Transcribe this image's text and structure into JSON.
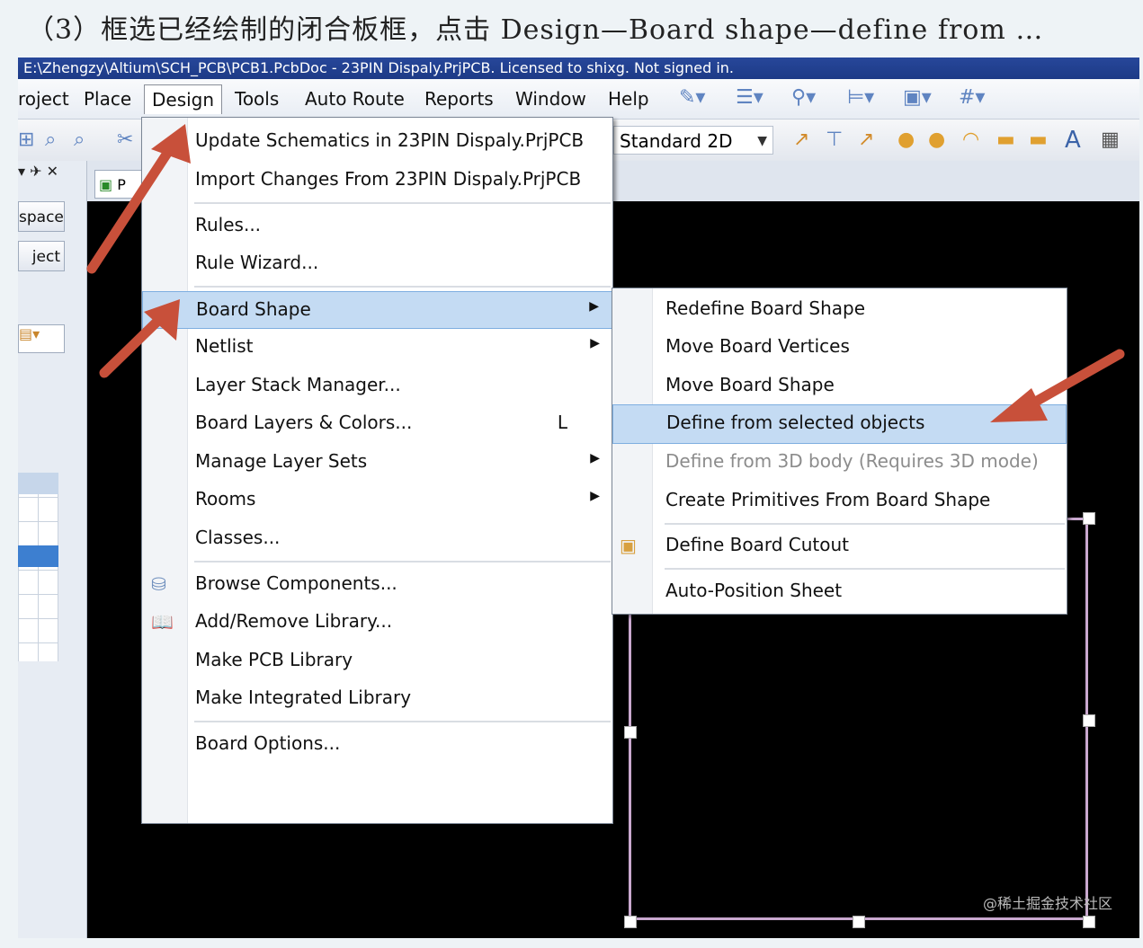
{
  "caption": "（3）框选已经绘制的闭合板框，点击 Design—Board shape—define from …",
  "window": {
    "title": "E:\\Zhengzy\\Altium\\SCH_PCB\\PCB1.PcbDoc - 23PIN Dispaly.PrjPCB. Licensed to shixg. Not signed in."
  },
  "menubar": {
    "project": "roject",
    "place": "Place",
    "design": "Design",
    "tools": "Tools",
    "auto_route": "Auto Route",
    "reports": "Reports",
    "window": "Window",
    "help": "Help"
  },
  "toolbar": {
    "view_mode": "Standard 2D"
  },
  "left_panel": {
    "workspace_btn": "space",
    "project_btn": "ject"
  },
  "doc_tab": {
    "label": "P"
  },
  "design_menu": {
    "items": [
      {
        "label": "Update Schematics in 23PIN Dispaly.PrjPCB"
      },
      {
        "label": "Import Changes From 23PIN Dispaly.PrjPCB"
      },
      {
        "label": "Rules..."
      },
      {
        "label": "Rule Wizard..."
      },
      {
        "label": "Board Shape"
      },
      {
        "label": "Netlist"
      },
      {
        "label": "Layer Stack Manager..."
      },
      {
        "label": "Board Layers & Colors...",
        "shortcut": "L"
      },
      {
        "label": "Manage Layer Sets"
      },
      {
        "label": "Rooms"
      },
      {
        "label": "Classes..."
      },
      {
        "label": "Browse Components..."
      },
      {
        "label": "Add/Remove Library..."
      },
      {
        "label": "Make PCB Library"
      },
      {
        "label": "Make Integrated Library"
      },
      {
        "label": "Board Options..."
      }
    ]
  },
  "board_shape_menu": {
    "items": [
      {
        "label": "Redefine Board Shape"
      },
      {
        "label": "Move Board Vertices"
      },
      {
        "label": "Move Board Shape"
      },
      {
        "label": "Define from selected objects"
      },
      {
        "label": "Define from 3D body (Requires 3D mode)"
      },
      {
        "label": "Create Primitives From Board Shape"
      },
      {
        "label": "Define Board Cutout"
      },
      {
        "label": "Auto-Position Sheet"
      }
    ]
  },
  "watermark": "@稀土掘金技术社区",
  "colors": {
    "highlight": "#c4dbf3",
    "annotation_arrow": "#c8503a",
    "board_outline": "#c9a8cf"
  }
}
